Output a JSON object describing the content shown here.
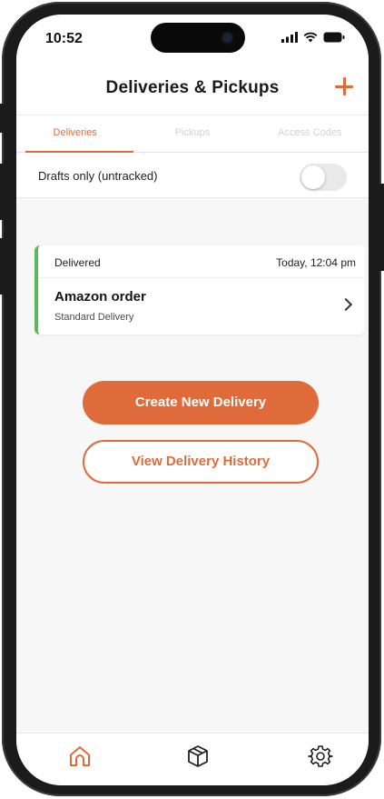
{
  "status_bar": {
    "time": "10:52"
  },
  "header": {
    "title": "Deliveries & Pickups",
    "add_icon": "plus-icon"
  },
  "tabs": [
    {
      "label": "Deliveries",
      "active": true
    },
    {
      "label": "Pickups",
      "active": false
    },
    {
      "label": "Access Codes",
      "active": false
    }
  ],
  "drafts": {
    "label": "Drafts only (untracked)",
    "enabled": false
  },
  "delivery_card": {
    "status": "Delivered",
    "time": "Today, 12:04 pm",
    "name": "Amazon order",
    "type": "Standard Delivery",
    "status_color": "#5cb85c"
  },
  "actions": {
    "create_label": "Create New Delivery",
    "history_label": "View Delivery History"
  },
  "bottom_nav": [
    {
      "icon": "home-icon",
      "active": true
    },
    {
      "icon": "package-icon",
      "active": false
    },
    {
      "icon": "settings-icon",
      "active": false
    }
  ],
  "colors": {
    "accent": "#e06b3a",
    "success": "#5cb85c",
    "background": "#f7f7f7"
  }
}
